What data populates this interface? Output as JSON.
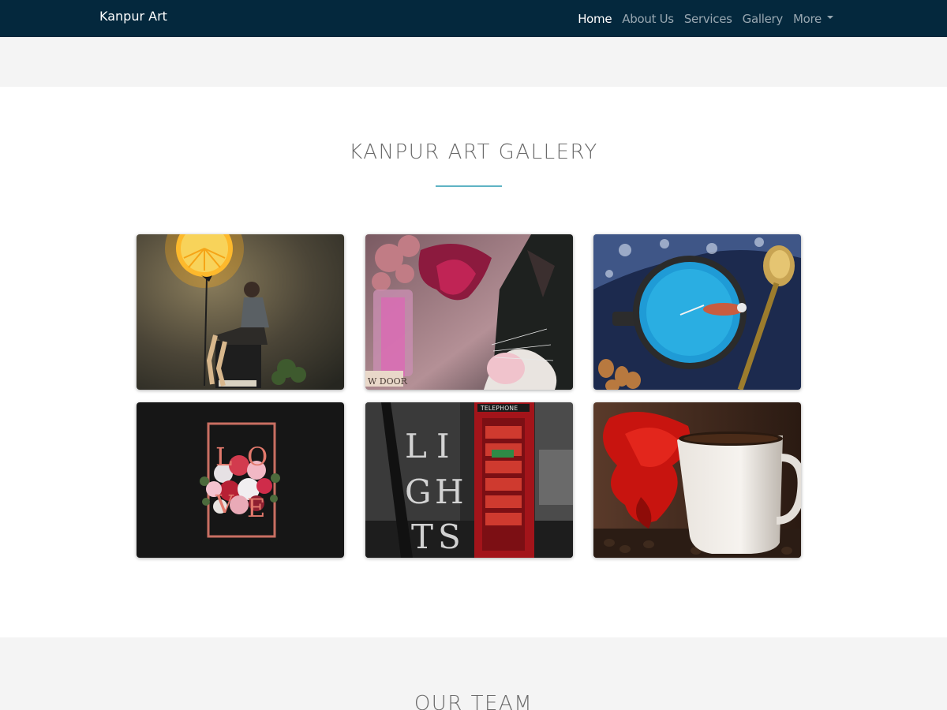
{
  "navbar": {
    "brand": "Kanpur Art",
    "links": [
      {
        "label": "Home",
        "active": true
      },
      {
        "label": "About Us",
        "active": false
      },
      {
        "label": "Services",
        "active": false
      },
      {
        "label": "Gallery",
        "active": false
      },
      {
        "label": "More",
        "active": false,
        "dropdown": true
      }
    ],
    "colors": {
      "background": "#04283d",
      "active_link": "#ffffff",
      "link": "#98a7b1"
    }
  },
  "gallery": {
    "title": "KANPUR ART GALLERY",
    "accent": "#5fb3c4",
    "items": [
      {
        "subject": "woman sitting under lemon lamp"
      },
      {
        "subject": "fish and cat with flower vase",
        "caption_fragment": "W DOOR"
      },
      {
        "subject": "swimmer in coffee cup with spoon"
      },
      {
        "subject": "flower bouquet with LOVE letters",
        "letters": "LOVE"
      },
      {
        "subject": "red telephone booth with LIGHTS lettering",
        "letters": "LIGHTS",
        "sign": "TELEPHONE"
      },
      {
        "subject": "red betta fish beside coffee mug"
      }
    ]
  },
  "team": {
    "title": "OUR TEAM"
  }
}
